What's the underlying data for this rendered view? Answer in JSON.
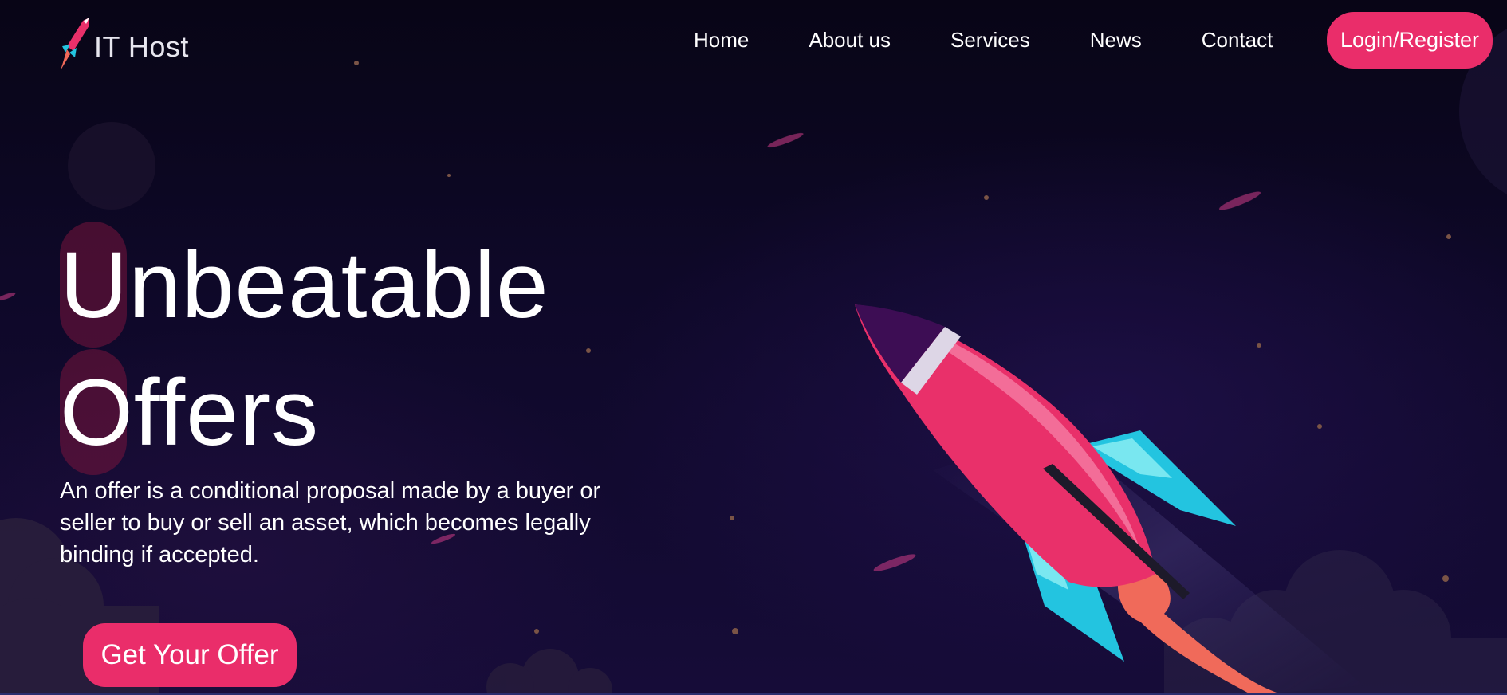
{
  "header": {
    "logo_text": "IT Host",
    "nav": [
      "Home",
      "About us",
      "Services",
      "News",
      "Contact"
    ],
    "login_label": "Login/Register"
  },
  "hero": {
    "headline_1": "Unbeatable",
    "headline_2": "Offers",
    "description": "An offer is a conditional proposal made by a buyer or seller to buy or sell an asset, which becomes legally binding if accepted.",
    "cta_label": "Get Your Offer"
  },
  "colors": {
    "accent": "#ea2d6a",
    "background": "#0c0822",
    "headline_pill": "#5a1236",
    "rocket_body": "#e9306a",
    "rocket_fins": "#23c4e0",
    "rocket_flame": "#f06a5a"
  },
  "icons": {
    "logo": "rocket-logo-icon",
    "illustration": "rocket-illustration"
  }
}
